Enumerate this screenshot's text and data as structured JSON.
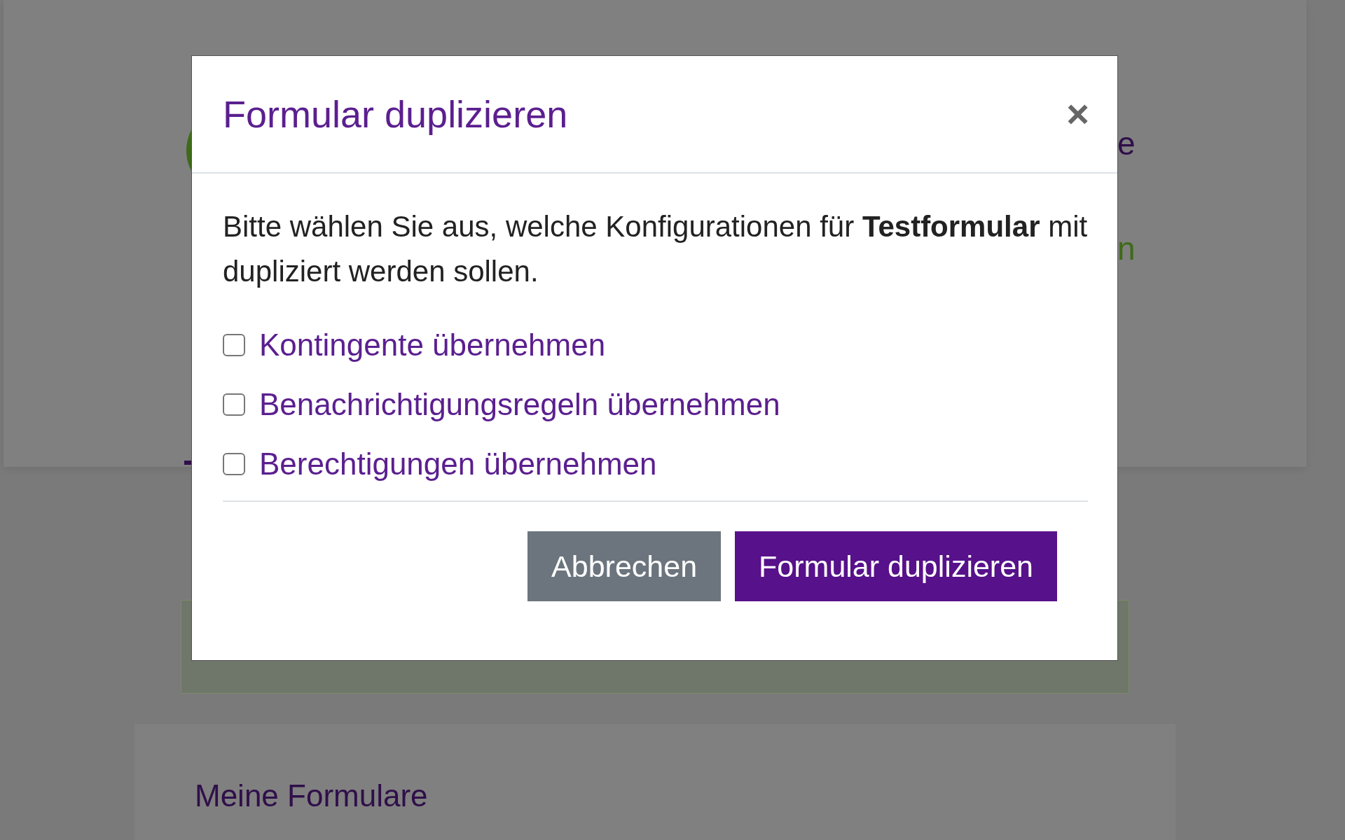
{
  "background": {
    "fragments": [
      {
        "text": "e",
        "kind": "heading"
      },
      {
        "text": "n",
        "kind": "link"
      }
    ],
    "section_title": "Meine Formulare"
  },
  "dialog": {
    "title": "Formular duplizieren",
    "close": "×",
    "message": "Bitte wählen Sie aus, welche Konfigurationen für **Testformular** mit dupliziert werden sollen.",
    "options": [
      {
        "label": "Kontingente übernehmen",
        "checked": false
      },
      {
        "label": "Benachrichtigungsregeln übernehmen",
        "checked": false
      },
      {
        "label": "Berechtigungen übernehmen",
        "checked": false
      }
    ],
    "buttons": [
      {
        "label": "Abbrechen",
        "kind": "secondary"
      },
      {
        "label": "Formular duplizieren",
        "kind": "primary"
      }
    ]
  }
}
